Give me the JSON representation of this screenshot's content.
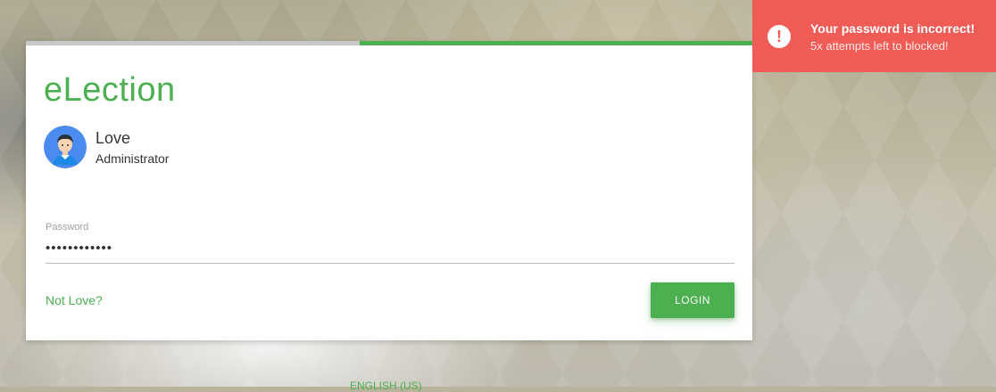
{
  "app": {
    "title": "eLection"
  },
  "user": {
    "name": "Love",
    "role": "Administrator",
    "avatar_icon": "user-avatar-icon"
  },
  "progress": {
    "value_percent": 54
  },
  "password": {
    "label": "Password",
    "value": "••••••••••••"
  },
  "actions": {
    "not_user_label": "Not Love?",
    "login_label": "LOGIN"
  },
  "footer": {
    "language_label": "ENGLISH (US)"
  },
  "toast": {
    "title": "Your password is incorrect!",
    "message": "5x attempts left to blocked!",
    "icon": "exclamation-icon"
  },
  "colors": {
    "accent": "#4caf50",
    "error": "#f05b55",
    "track": "#c8c8c8"
  }
}
